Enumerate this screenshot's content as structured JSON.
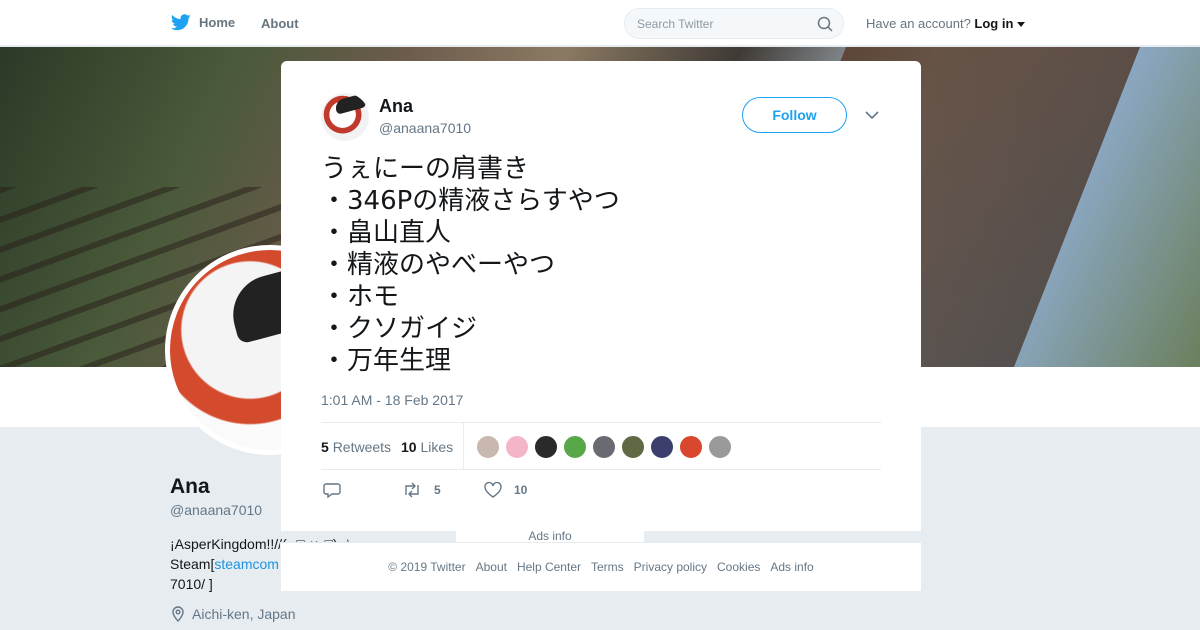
{
  "nav": {
    "home_label": "Home",
    "about_label": "About",
    "search_placeholder": "Search Twitter",
    "account_prompt": "Have an account?",
    "login_label": "Log in"
  },
  "profile": {
    "name": "Ana",
    "handle": "@anaana7010",
    "bio_line1": "¡AsperKingdom!!//(-•□ ω•□) ☆",
    "bio_prefix": "Steam[",
    "bio_link": "steamcom",
    "bio_line3": "7010/ ]",
    "location": "Aichi-ken, Japan",
    "ads_info": "Ads info"
  },
  "tweet": {
    "author_name": "Ana",
    "author_handle": "@anaana7010",
    "follow_label": "Follow",
    "lines": [
      "うぇにーの肩書き",
      "・346Pの精液さらすやつ",
      "・畠山直人",
      "・精液のやべーやつ",
      "・ホモ",
      "・クソガイジ",
      "・万年生理"
    ],
    "timestamp": "1:01 AM - 18 Feb 2017",
    "retweets_count": "5",
    "retweets_label": "Retweets",
    "likes_count": "10",
    "likes_label": "Likes",
    "action_retweets": "5",
    "action_likes": "10",
    "liker_colors": [
      "#c9b8b0",
      "#f3b6c8",
      "#2a2a2a",
      "#58a84a",
      "#6a6a72",
      "#5f6a44",
      "#3b3f6e",
      "#d9482e",
      "#9a9a9a"
    ]
  },
  "footer": {
    "links": [
      "© 2019 Twitter",
      "About",
      "Help Center",
      "Terms",
      "Privacy policy",
      "Cookies",
      "Ads info"
    ]
  },
  "colors": {
    "accent": "#1da1f2",
    "muted": "#657786"
  }
}
